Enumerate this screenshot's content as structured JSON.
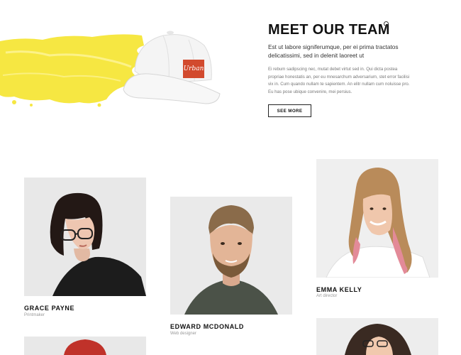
{
  "section": {
    "title": "MEET OUR TEAM",
    "lead": "Est ut labore signiferumque, per ei prima tractatos delicatissimi, sed in delenit laoreet ut",
    "body": "Ei rebum sadipscing nec, mutat debet virtut sed in. Qui dicta postea propriae honestatis an, per eu mnesarchum adversarium, stet error facilisi vix in. Cum quando nullam te sapientem. An elitr nullam cum noluisse pro. Eu has pose ubique convenire, mei persius.",
    "button_label": "SEE MORE"
  },
  "cap": {
    "logo_text": "Urban"
  },
  "colors": {
    "accent_yellow": "#f6e742",
    "cap_logo": "#d24a2e"
  },
  "team": [
    {
      "name": "GRACE PAYNE",
      "role": "Printmaker"
    },
    {
      "name": "EDWARD MCDONALD",
      "role": "Web designer"
    },
    {
      "name": "EMMA KELLY",
      "role": "Art director"
    }
  ]
}
